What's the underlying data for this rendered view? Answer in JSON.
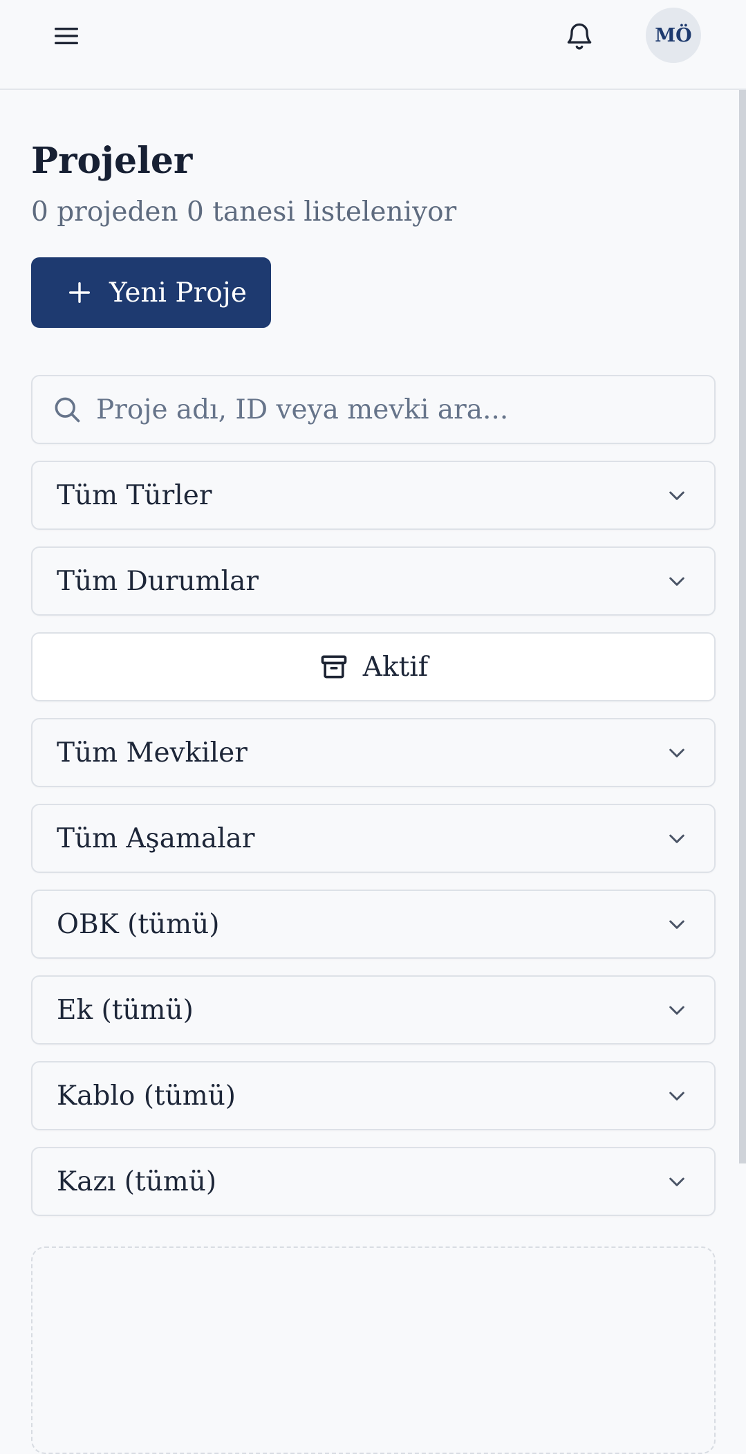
{
  "header": {
    "menu_icon": "hamburger-menu-icon",
    "bell_icon": "bell-icon",
    "avatar_initials": "MÖ"
  },
  "page": {
    "title": "Projeler",
    "subtitle": "0 projeden 0 tanesi listeleniyor",
    "new_button_label": "Yeni Proje",
    "new_button_icon": "plus-icon"
  },
  "search": {
    "placeholder": "Proje adı, ID veya mevki ara...",
    "value": ""
  },
  "filters": {
    "types": "Tüm Türler",
    "statuses": "Tüm Durumlar",
    "active_toggle": "Aktif",
    "locations": "Tüm Mevkiler",
    "phases": "Tüm Aşamalar",
    "obk": "OBK (tümü)",
    "ek": "Ek (tümü)",
    "cable": "Kablo (tümü)",
    "excavation": "Kazı (tümü)"
  },
  "colors": {
    "primary": "#1e3a70",
    "background": "#f8f9fb",
    "muted_text": "#5e6b7f",
    "border": "#dde1e7"
  }
}
